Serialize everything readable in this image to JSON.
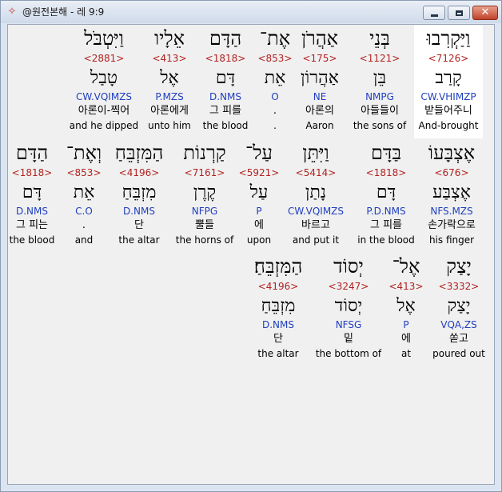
{
  "window": {
    "title": "@원전본해 - 레 9:9",
    "app_icon": "bible-app-icon",
    "minimize_glyph": "minimize-icon",
    "maximize_glyph": "maximize-icon",
    "close_glyph": "✕"
  },
  "rows": [
    [
      {
        "hebrew": "וַיַּקְרִבוּ",
        "strong": "<7126>",
        "lemma": "קָרַב",
        "morph": "CW.VHIMZP",
        "korean": "받들어주니",
        "english": "And-brought"
      },
      {
        "hebrew": "בְּנֵי",
        "strong": "<1121>",
        "lemma": "בֵּן",
        "morph": "NMPG",
        "korean": "아들들이",
        "english": "the sons of"
      },
      {
        "hebrew": "אַהֲרֹן",
        "strong": "<175>",
        "lemma": "אַהֲרוֹן",
        "morph": "NE",
        "korean": "아론의",
        "english": "Aaron"
      },
      {
        "hebrew": "אֶת־",
        "strong": "<853>",
        "lemma": "אֵת",
        "morph": "O",
        "korean": ".",
        "english": "."
      },
      {
        "hebrew": "הַדָּם",
        "strong": "<1818>",
        "lemma": "דָּם",
        "morph": "D.NMS",
        "korean": "그 피를",
        "english": "the blood"
      },
      {
        "hebrew": "אֵלָיו",
        "strong": "<413>",
        "lemma": "אֶל",
        "morph": "P.MZS",
        "korean": "아론에게",
        "english": "unto him"
      },
      {
        "hebrew": "וַיִּטְבֹּל",
        "strong": "<2881>",
        "lemma": "טָבַל",
        "morph": "CW.VQIMZS",
        "korean": "아론이-찍어",
        "english": "and he dipped"
      }
    ],
    [
      {
        "hebrew": "אֶצְבָּעוֹ",
        "strong": "<676>",
        "lemma": "אֶצְבַּע",
        "morph": "NFS.MZS",
        "korean": "손가락으로",
        "english": "his finger"
      },
      {
        "hebrew": "בַּדָּם",
        "strong": "<1818>",
        "lemma": "דָּם",
        "morph": "P.D.NMS",
        "korean": "그 피를",
        "english": "in the blood"
      },
      {
        "hebrew": "וַיִּתֵּן",
        "strong": "<5414>",
        "lemma": "נָתַן",
        "morph": "CW.VQIMZS",
        "korean": "바르고",
        "english": "and put it"
      },
      {
        "hebrew": "עַל־",
        "strong": "<5921>",
        "lemma": "עַל",
        "morph": "P",
        "korean": "에",
        "english": "upon"
      },
      {
        "hebrew": "קַרְנוֹת",
        "strong": "<7161>",
        "lemma": "קֶרֶן",
        "morph": "NFPG",
        "korean": "뿔들",
        "english": "the horns of"
      },
      {
        "hebrew": "הַמִּזְבֵּחַ",
        "strong": "<4196>",
        "lemma": "מִזְבֵּחַ",
        "morph": "D.NMS",
        "korean": "단",
        "english": "the altar"
      },
      {
        "hebrew": "וְאֶת־",
        "strong": "<853>",
        "lemma": "אֵת",
        "morph": "C.O",
        "korean": ".",
        "english": "and"
      },
      {
        "hebrew": "הַדָּם",
        "strong": "<1818>",
        "lemma": "דָּם",
        "morph": "D.NMS",
        "korean": "그 피는",
        "english": "the blood"
      }
    ],
    [
      {
        "hebrew": "יָצַק",
        "strong": "<3332>",
        "lemma": "יָצַק",
        "morph": "VQA,ZS",
        "korean": "쏟고",
        "english": "poured out"
      },
      {
        "hebrew": "אֶל־",
        "strong": "<413>",
        "lemma": "אֶל",
        "morph": "P",
        "korean": "에",
        "english": "at"
      },
      {
        "hebrew": "יְסוֹד",
        "strong": "<3247>",
        "lemma": "יְסוֹד",
        "morph": "NFSG",
        "korean": "밑",
        "english": "the bottom of"
      },
      {
        "hebrew": "הַמִּזְבֵּחַ׃",
        "strong": "<4196>",
        "lemma": "מִזְבֵּחַ",
        "morph": "D.NMS",
        "korean": "단",
        "english": "the altar"
      }
    ]
  ],
  "colors": {
    "strong_number": "#b22222",
    "morphology": "#1f3fbf",
    "selected_background": "#ffffff",
    "content_background": "#f0f0f0"
  }
}
